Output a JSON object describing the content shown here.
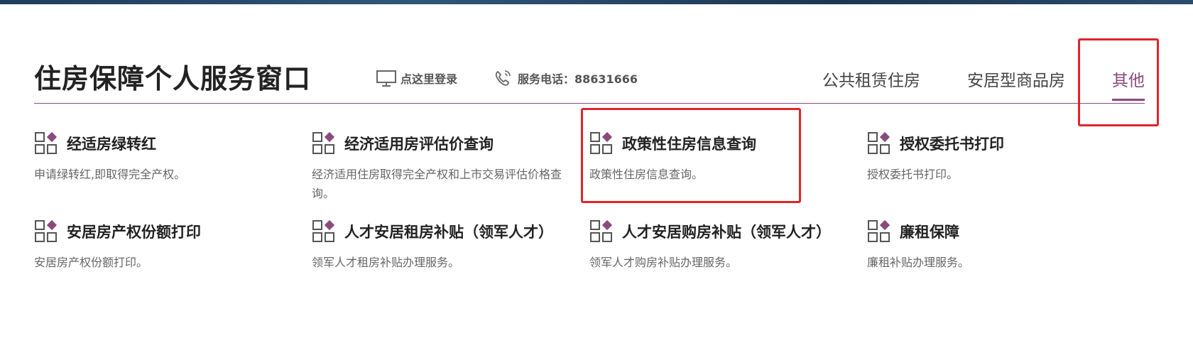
{
  "header": {
    "title": "住房保障个人服务窗口",
    "login_label": "点这里登录",
    "phone_label": "服务电话：88631666"
  },
  "tabs": [
    {
      "label": "公共租赁住房",
      "active": false
    },
    {
      "label": "安居型商品房",
      "active": false
    },
    {
      "label": "其他",
      "active": true
    }
  ],
  "services": [
    {
      "title": "经适房绿转红",
      "desc": "申请绿转红,即取得完全产权。"
    },
    {
      "title": "经济适用房评估价查询",
      "desc": "经济适用住房取得完全产权和上市交易评估价格查询。"
    },
    {
      "title": "政策性住房信息查询",
      "desc": "政策性住房信息查询。"
    },
    {
      "title": "授权委托书打印",
      "desc": "授权委托书打印。"
    },
    {
      "title": "安居房产权份额打印",
      "desc": "安居房产权份额打印。"
    },
    {
      "title": "人才安居租房补贴（领军人才）",
      "desc": "领军人才租房补贴办理服务。"
    },
    {
      "title": "人才安居购房补贴（领军人才）",
      "desc": "领军人才购房补贴办理服务。"
    },
    {
      "title": "廉租保障",
      "desc": "廉租补贴办理服务。"
    }
  ],
  "colors": {
    "accent": "#8a4a7c",
    "highlight": "#e0242a"
  },
  "icons": {
    "login": "monitor-icon",
    "phone": "phone-icon",
    "service": "grid-diamond-icon"
  }
}
